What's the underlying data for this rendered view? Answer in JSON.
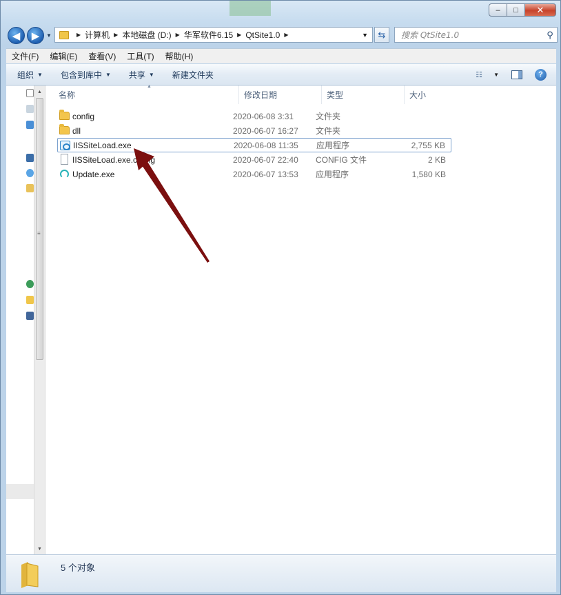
{
  "window": {
    "controls": {
      "minimize": "‒",
      "maximize": "□",
      "close": "✕"
    }
  },
  "nav": {
    "back_icon": "◀",
    "forward_icon": "▶",
    "breadcrumbs": [
      "计算机",
      "本地磁盘 (D:)",
      "华军软件6.15",
      "QtSite1.0"
    ],
    "search_placeholder": "搜索 QtSite1.0"
  },
  "menubar": {
    "items": [
      "文件(F)",
      "编辑(E)",
      "查看(V)",
      "工具(T)",
      "帮助(H)"
    ]
  },
  "toolbar": {
    "organize": "组织",
    "include_library": "包含到库中",
    "share": "共享",
    "new_folder": "新建文件夹",
    "help": "?"
  },
  "columns": {
    "name": "名称",
    "date": "修改日期",
    "type": "类型",
    "size": "大小"
  },
  "files": [
    {
      "name": "config",
      "date": "2020-06-08 3:31",
      "type": "文件夹",
      "size": "",
      "icon": "folder-icon"
    },
    {
      "name": "dll",
      "date": "2020-06-07 16:27",
      "type": "文件夹",
      "size": "",
      "icon": "folder-icon"
    },
    {
      "name": "IISSiteLoad.exe",
      "date": "2020-06-08 11:35",
      "type": "应用程序",
      "size": "2,755 KB",
      "icon": "app-icon",
      "selected": true
    },
    {
      "name": "IISSiteLoad.exe.config",
      "date": "2020-06-07 22:40",
      "type": "CONFIG 文件",
      "size": "2 KB",
      "icon": "document-icon"
    },
    {
      "name": "Update.exe",
      "date": "2020-06-07 13:53",
      "type": "应用程序",
      "size": "1,580 KB",
      "icon": "update-icon"
    }
  ],
  "status": {
    "item_count": "5 个对象"
  },
  "colors": {
    "annotation_arrow": "#7b0f0f",
    "selection_border": "#7da2ce"
  }
}
